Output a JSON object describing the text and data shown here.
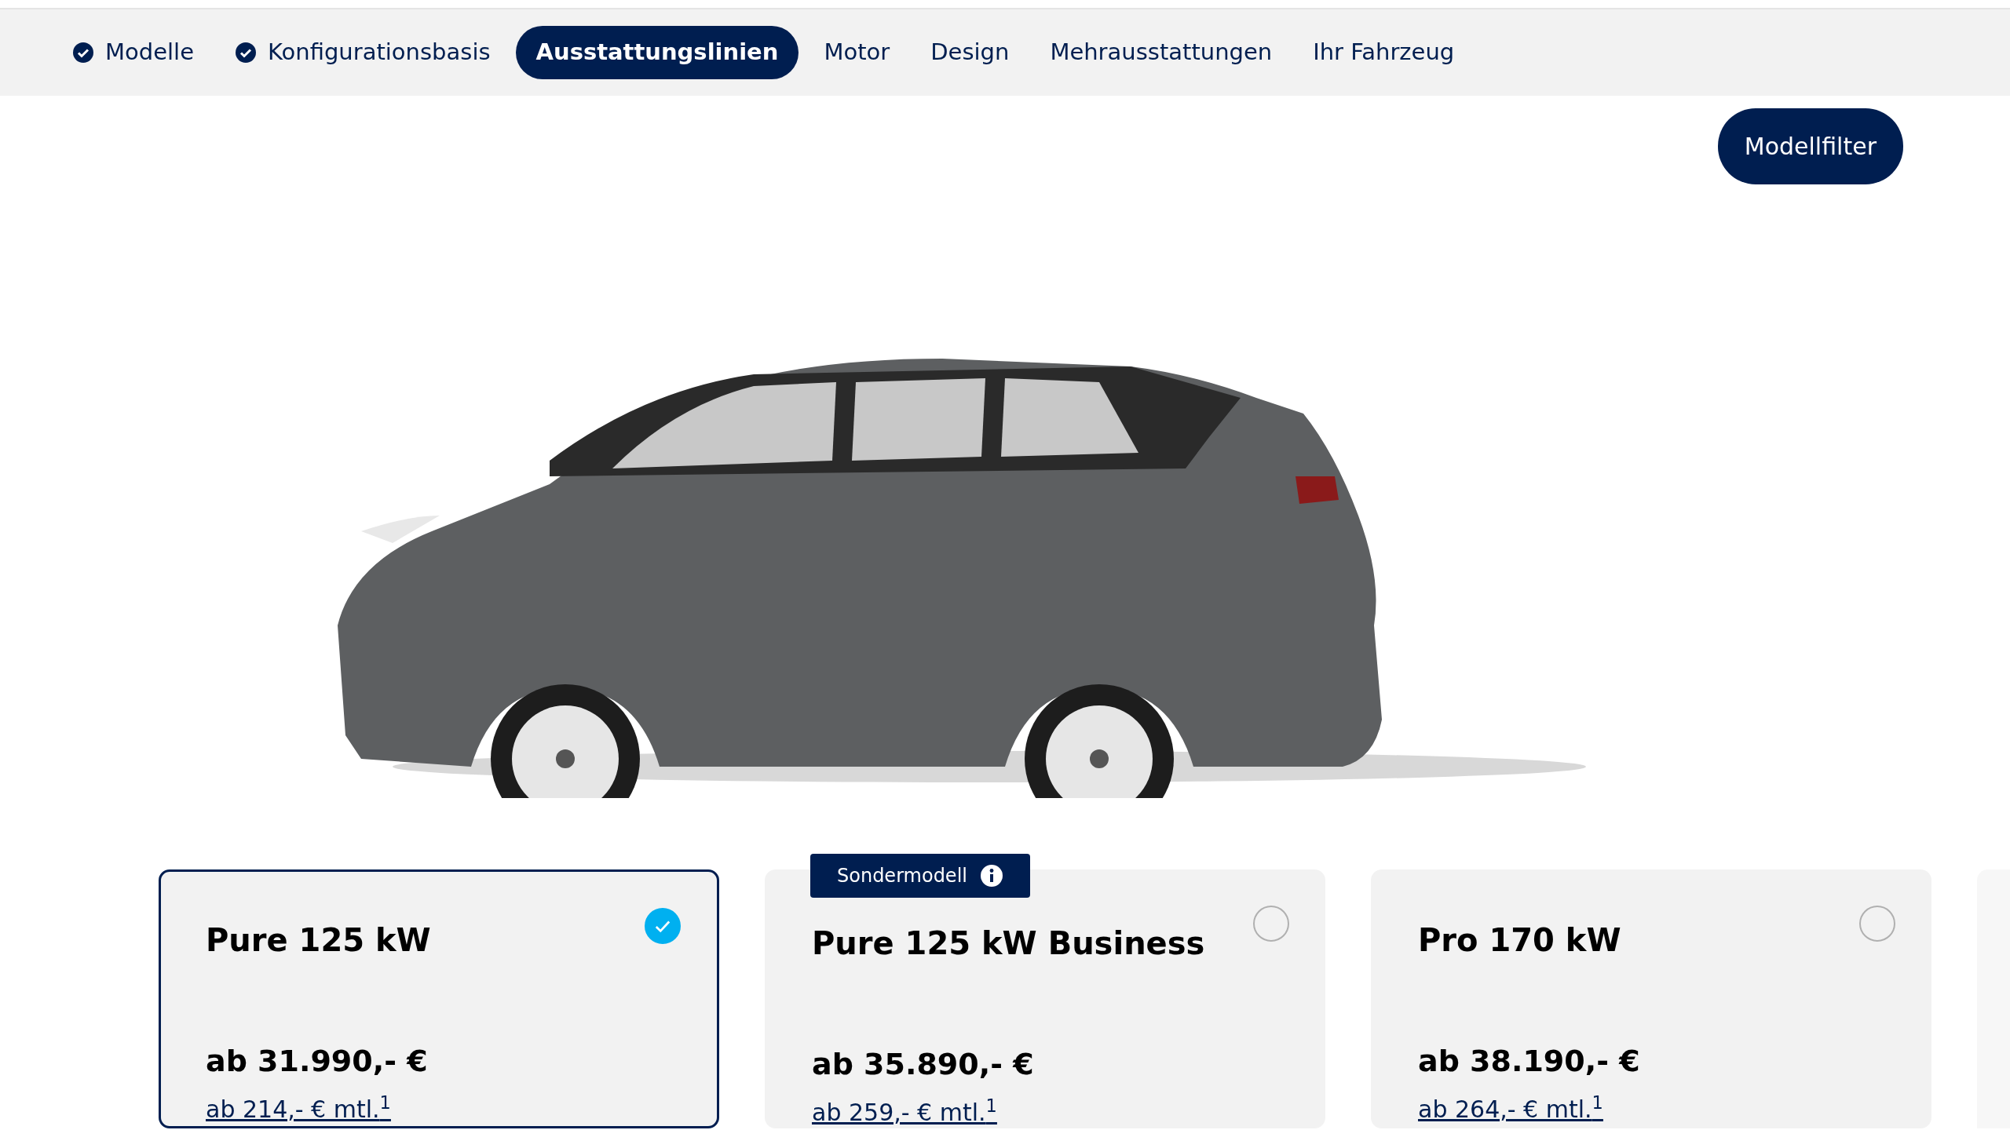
{
  "steps": [
    {
      "label": "Modelle",
      "completed": true,
      "selected": false
    },
    {
      "label": "Konfigurationsbasis",
      "completed": true,
      "selected": false
    },
    {
      "label": "Ausstattungslinien",
      "completed": false,
      "selected": true
    },
    {
      "label": "Motor",
      "completed": false,
      "selected": false
    },
    {
      "label": "Design",
      "completed": false,
      "selected": false
    },
    {
      "label": "Mehrausstattungen",
      "completed": false,
      "selected": false
    },
    {
      "label": "Ihr Fahrzeug",
      "completed": false,
      "selected": false
    }
  ],
  "filter_button": "Modellfilter",
  "trims": [
    {
      "name": "Pure 125 kW",
      "price": "ab 31.990,- €",
      "monthly": "ab 214,- € mtl.$^{1}$",
      "selected": true
    },
    {
      "name": "Pure 125 kW Business",
      "badge": "Sondermodell",
      "price": "ab 35.890,- €",
      "monthly": "ab 259,- € mtl.$^{1}$",
      "selected": false
    },
    {
      "name": "Pro 170 kW",
      "price": "ab 38.190,- €",
      "monthly": "ab 264,- € mtl.$^{1}$",
      "selected": false
    }
  ]
}
